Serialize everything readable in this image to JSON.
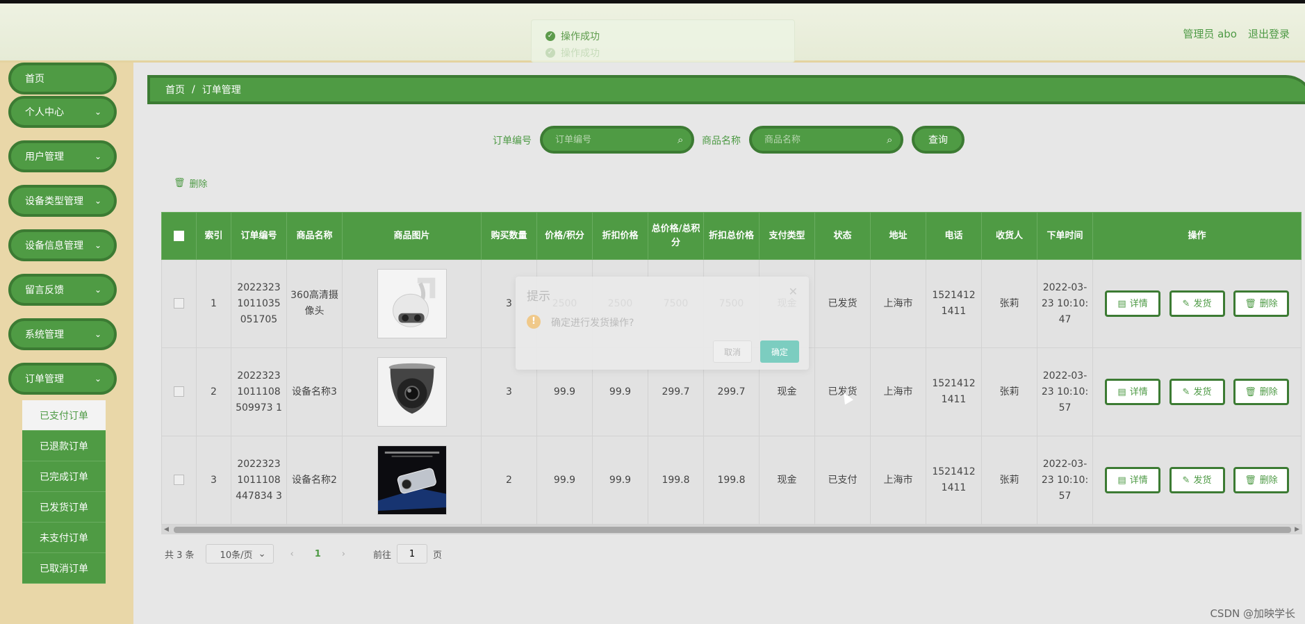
{
  "header": {
    "user": "管理员 abo",
    "logout": "退出登录",
    "toast_messages": [
      "操作成功",
      "操作成功"
    ]
  },
  "sidebar": {
    "items": [
      {
        "label": "首页"
      },
      {
        "label": "个人中心"
      },
      {
        "label": "用户管理"
      },
      {
        "label": "设备类型管理"
      },
      {
        "label": "设备信息管理"
      },
      {
        "label": "留言反馈"
      },
      {
        "label": "系统管理"
      },
      {
        "label": "订单管理"
      }
    ],
    "submenu": [
      "已支付订单",
      "已退款订单",
      "已完成订单",
      "已发货订单",
      "未支付订单",
      "已取消订单"
    ],
    "active_submenu": "已支付订单"
  },
  "breadcrumb": {
    "home": "首页",
    "separator": "/",
    "current": "订单管理"
  },
  "search": {
    "order_label": "订单编号",
    "order_placeholder": "订单编号",
    "product_label": "商品名称",
    "product_placeholder": "商品名称",
    "query_button": "查询"
  },
  "toolbar": {
    "delete_label": "删除"
  },
  "table": {
    "columns": [
      "索引",
      "订单编号",
      "商品名称",
      "商品图片",
      "购买数量",
      "价格/积分",
      "折扣价格",
      "总价格/总积分",
      "折扣总价格",
      "支付类型",
      "状态",
      "地址",
      "电话",
      "收货人",
      "下单时间",
      "操作"
    ],
    "rows": [
      {
        "index": "1",
        "order_no": "20223231011035051705",
        "product": "360高清摄像头",
        "image": "dome-camera-image",
        "qty": "3",
        "price": "2500",
        "discount_price": "2500",
        "total": "7500",
        "discount_total": "7500",
        "pay_type": "现金",
        "status": "已发货",
        "address": "上海市",
        "phone": "15214121411",
        "receiver": "张莉",
        "time": "2022-03-23 10:10:47"
      },
      {
        "index": "2",
        "order_no": "20223231011108509973 1",
        "product": "设备名称3",
        "image": "ceiling-camera-image",
        "qty": "3",
        "price": "99.9",
        "discount_price": "99.9",
        "total": "299.7",
        "discount_total": "299.7",
        "pay_type": "现金",
        "status": "已发货",
        "address": "上海市",
        "phone": "15214121411",
        "receiver": "张莉",
        "time": "2022-03-23 10:10:57"
      },
      {
        "index": "3",
        "order_no": "20223231011108447834 3",
        "product": "设备名称2",
        "image": "dashcam-image",
        "qty": "2",
        "price": "99.9",
        "discount_price": "99.9",
        "total": "199.8",
        "discount_total": "199.8",
        "pay_type": "现金",
        "status": "已支付",
        "address": "上海市",
        "phone": "15214121411",
        "receiver": "张莉",
        "time": "2022-03-23 10:10:57"
      }
    ],
    "actions": {
      "detail": "详情",
      "ship": "发货",
      "delete": "删除"
    }
  },
  "pagination": {
    "total": "共 3 条",
    "page_size": "10条/页",
    "current": "1",
    "goto_label": "前往",
    "goto_value": "1",
    "page_suffix": "页"
  },
  "dialog": {
    "title": "提示",
    "message": "确定进行发货操作?",
    "cancel": "取消",
    "confirm": "确定"
  },
  "watermark": "CSDN @加映学长",
  "colors": {
    "primary": "#4f9b44",
    "primary_dark": "#3c7b33",
    "sidebar_bg": "#e9d7a8",
    "dialog_confirm": "#7ccdc0"
  }
}
